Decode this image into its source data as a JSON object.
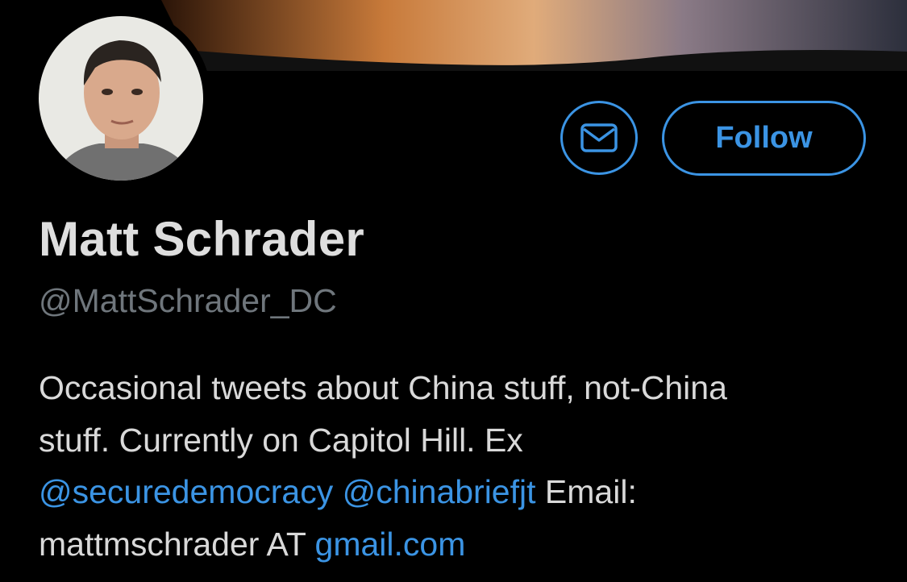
{
  "profile": {
    "display_name": "Matt Schrader",
    "handle": "@MattSchrader_DC",
    "bio": {
      "line1": "Occasional tweets about China stuff, not-China",
      "line2": "stuff. Currently on Capitol Hill. Ex",
      "mention1": "@securedemocracy",
      "mention2": "@chinabriefjt",
      "line3_tail": "Email:",
      "line4_head": "mattmschrader AT ",
      "link": "gmail.com"
    }
  },
  "actions": {
    "message_icon": "envelope-icon",
    "follow_label": "Follow"
  },
  "colors": {
    "background": "#000000",
    "accent": "#3b94e4",
    "name_text": "#dedede",
    "handle_text": "#6f767c",
    "body_text": "#d9d9d9"
  }
}
